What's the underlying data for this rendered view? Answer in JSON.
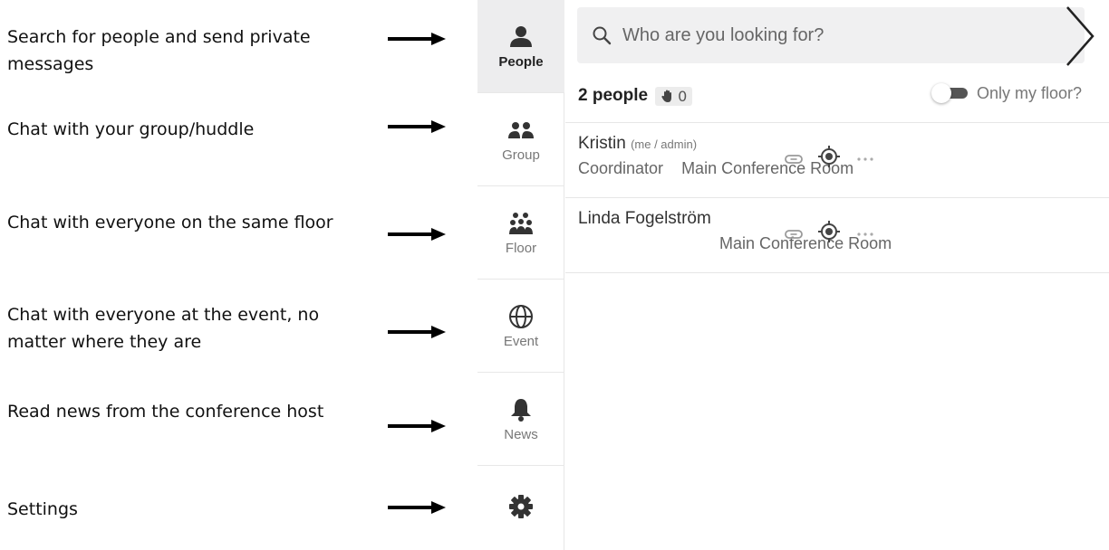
{
  "annotations": [
    "Search for people and send private messages",
    "Chat with your group/huddle",
    "Chat with everyone on the same floor",
    "Chat with everyone at the event, no matter where they are",
    "Read news from the conference host",
    "Settings"
  ],
  "sidebar": {
    "items": [
      {
        "label": "People",
        "icon": "person-icon",
        "active": true
      },
      {
        "label": "Group",
        "icon": "group-icon"
      },
      {
        "label": "Floor",
        "icon": "crowd-icon"
      },
      {
        "label": "Event",
        "icon": "globe-icon"
      },
      {
        "label": "News",
        "icon": "bell-icon"
      },
      {
        "label": "",
        "icon": "gear-icon"
      }
    ]
  },
  "search": {
    "placeholder": "Who are you looking for?"
  },
  "summary": {
    "count_text": "2 people",
    "hand_count": "0",
    "toggle_label": "Only my floor?",
    "toggle_on": false
  },
  "people": [
    {
      "name": "Kristin",
      "tag": "(me / admin)",
      "title": "Coordinator",
      "room": "Main Conference Room"
    },
    {
      "name": "Linda Fogelström",
      "tag": "",
      "title": "",
      "room": "Main Conference Room"
    }
  ],
  "colors": {
    "active_bg": "#ededee",
    "search_bg": "#f0f0f1",
    "icon_dark": "#333333"
  }
}
